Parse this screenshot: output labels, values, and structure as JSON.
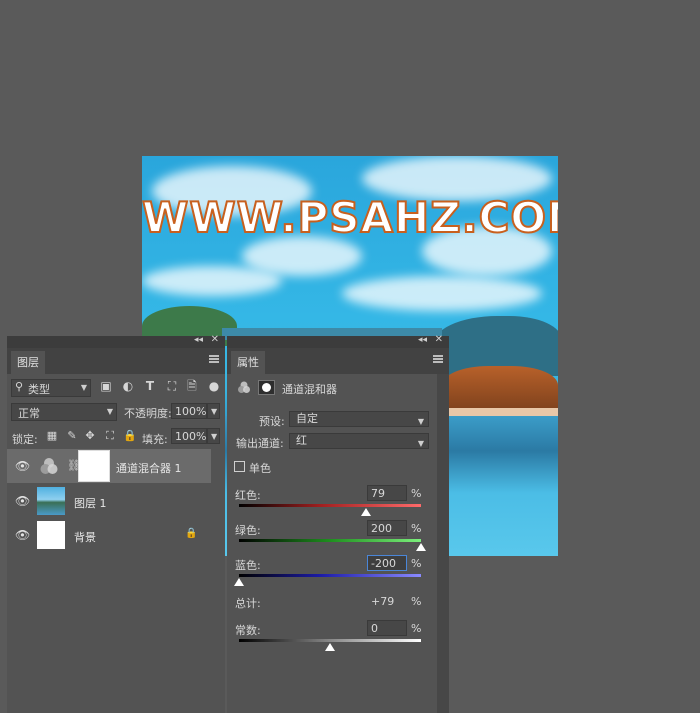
{
  "canvas": {
    "watermark": "WWW.PSAHZ.COM"
  },
  "layers_panel": {
    "tab_label": "图层",
    "filter_kind": "类型",
    "blend_mode": "正常",
    "opacity_label": "不透明度:",
    "opacity_value": "100%",
    "lock_label": "锁定:",
    "fill_label": "填充:",
    "fill_value": "100%",
    "layers": [
      {
        "name": "通道混合器 1",
        "selected": true
      },
      {
        "name": "图层 1",
        "selected": false
      },
      {
        "name": "背景",
        "selected": false,
        "locked": true
      }
    ]
  },
  "properties_panel": {
    "tab_label": "属性",
    "adjustment_title": "通道混和器",
    "preset_label": "预设:",
    "preset_value": "自定",
    "output_channel_label": "输出通道:",
    "output_channel_value": "红",
    "monochrome_label": "单色",
    "monochrome_checked": false,
    "sliders": [
      {
        "label": "红色:",
        "value": "79",
        "unit": "%",
        "min": -200,
        "max": 200,
        "amount": 79,
        "color": "#cc2a2a"
      },
      {
        "label": "绿色:",
        "value": "200",
        "unit": "%",
        "min": -200,
        "max": 200,
        "amount": 200,
        "color": "#2ec02e"
      },
      {
        "label": "蓝色:",
        "value": "-200",
        "unit": "%",
        "min": -200,
        "max": 200,
        "amount": -200,
        "color": "#2a2acc"
      }
    ],
    "total_label": "总计:",
    "total_value": "+79",
    "total_unit": "%",
    "constant": {
      "label": "常数:",
      "value": "0",
      "unit": "%",
      "min": -200,
      "max": 200,
      "amount": 0
    }
  }
}
